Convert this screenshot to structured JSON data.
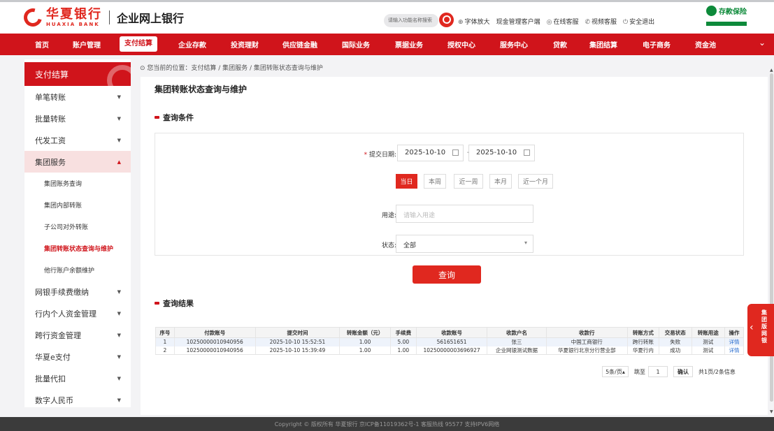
{
  "header": {
    "bank_cn": "华夏银行",
    "bank_en": "HUAXIA BANK",
    "app_title": "企业网上银行",
    "search_placeholder": "请输入功能名称搜索",
    "tools": [
      "字体放大",
      "现金管理客户端",
      "在线客服",
      "视频客服",
      "安全退出"
    ],
    "badge": "存款保险",
    "brand_color": "#d0141b"
  },
  "nav": {
    "items": [
      "首页",
      "账户管理",
      "支付结算",
      "企业存款",
      "投资理财",
      "供应链金融",
      "国际业务",
      "票据业务",
      "授权中心",
      "服务中心",
      "贷款",
      "集团结算",
      "电子商务",
      "资金池"
    ],
    "active": "支付结算"
  },
  "sidebar": {
    "title": "支付结算",
    "items": [
      {
        "label": "单笔转账",
        "arrow": "▼"
      },
      {
        "label": "批量转账",
        "arrow": "▼"
      },
      {
        "label": "代发工资",
        "arrow": "▼"
      },
      {
        "label": "集团服务",
        "arrow": "▲"
      },
      {
        "label": "网银手续费缴纳",
        "arrow": "▼"
      },
      {
        "label": "行内个人资金管理",
        "arrow": "▼"
      },
      {
        "label": "跨行资金管理",
        "arrow": "▼"
      },
      {
        "label": "华夏e支付",
        "arrow": "▼"
      },
      {
        "label": "批量代扣",
        "arrow": "▼"
      },
      {
        "label": "数字人民币",
        "arrow": "▼"
      }
    ],
    "sub_items": [
      "集团账务查询",
      "集团内部转账",
      "子公司对外转账",
      "集团转账状态查询与维护",
      "他行账户余额维护"
    ]
  },
  "breadcrumb": "您当前的位置：支付结算 / 集团服务 / 集团转账状态查询与维护",
  "page_title": "集团转账状态查询与维护",
  "query": {
    "section_title": "查询条件",
    "date_label": "提交日期:",
    "date_from": "2025-10-10",
    "date_to": "2025-10-10",
    "quick_ranges": [
      "当日",
      "本周",
      "近一周",
      "本月",
      "近一个月"
    ],
    "purpose_label": "用途:",
    "purpose_placeholder": "请输入用途",
    "status_label": "状态:",
    "status_value": "全部",
    "submit_label": "查询"
  },
  "results": {
    "section_title": "查询结果",
    "columns": [
      "序号",
      "付款账号",
      "提交时间",
      "转账金额（元）",
      "手续费",
      "收款账号",
      "收款户名",
      "收款行",
      "转账方式",
      "交易状态",
      "转账用途",
      "操作"
    ],
    "rows": [
      [
        "1",
        "10250000010940956",
        "2025-10-10 15:52:51",
        "1.00",
        "5.00",
        "561651651",
        "张三",
        "中国工商银行",
        "跨行转账",
        "失败",
        "测试",
        "详情"
      ],
      [
        "2",
        "10250000010940956",
        "2025-10-10 15:39:49",
        "1.00",
        "1.00",
        "10250000003696927",
        "企业网银测试数据",
        "华夏银行北京分行营业部",
        "华夏行内",
        "成功",
        "测试",
        "详情"
      ]
    ]
  },
  "pager": {
    "page_size": "5条/页",
    "goto_label": "跳至",
    "goto_value": "1",
    "confirm_label": "确认",
    "summary": "共1页/2条信息"
  },
  "float_tab": "集团版网银",
  "footer": "Copyright © 版权所有 华夏银行 京ICP备11019362号-1 客服热线 95577 支持IPV6网络"
}
